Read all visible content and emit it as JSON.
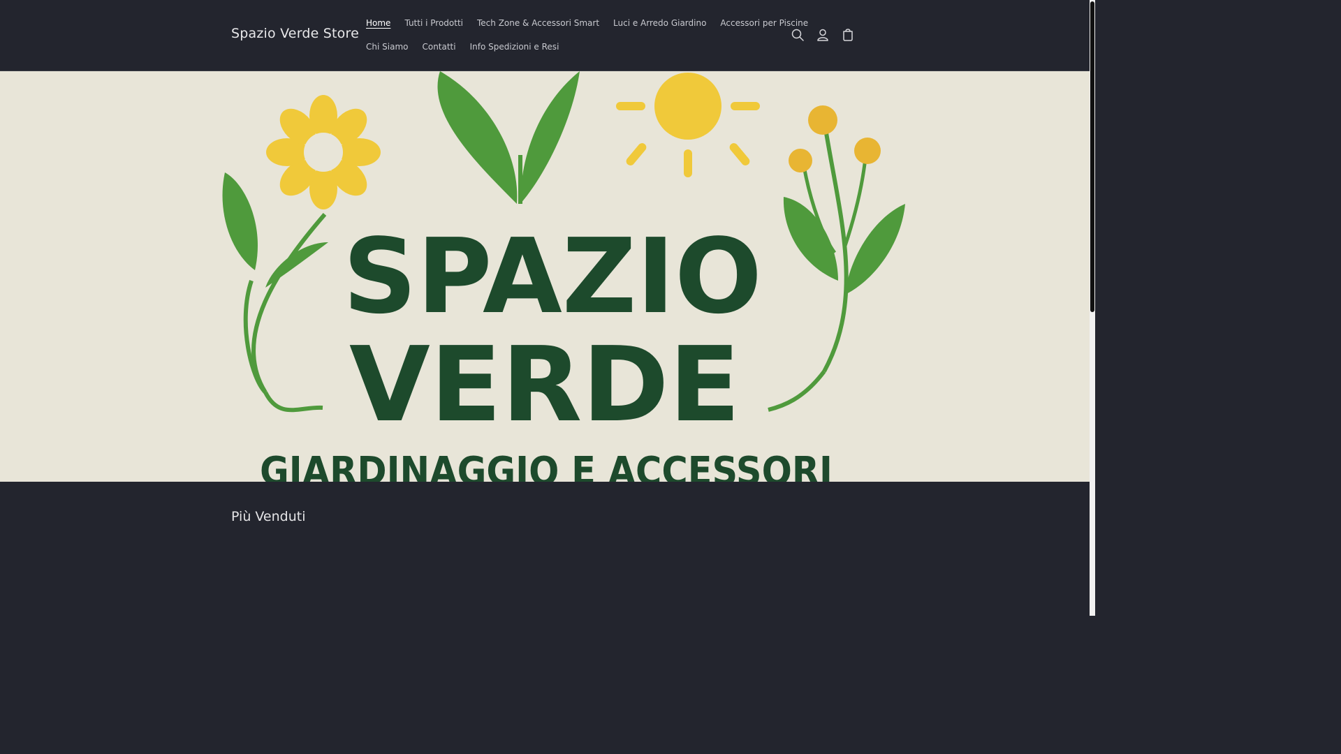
{
  "header": {
    "brand": "Spazio Verde Store",
    "nav_row1": [
      {
        "label": "Home",
        "active": true
      },
      {
        "label": "Tutti i Prodotti",
        "active": false
      },
      {
        "label": "Tech Zone & Accessori Smart",
        "active": false
      },
      {
        "label": "Luci e Arredo Giardino",
        "active": false
      },
      {
        "label": "Accessori per Piscine",
        "active": false
      }
    ],
    "nav_row2": [
      {
        "label": "Chi Siamo",
        "active": false
      },
      {
        "label": "Contatti",
        "active": false
      },
      {
        "label": "Info Spedizioni e Resi",
        "active": false
      }
    ],
    "icons": [
      "search-icon",
      "account-icon",
      "cart-icon"
    ]
  },
  "hero": {
    "logo_line1": "SPAZIO",
    "logo_line2": "VERDE",
    "logo_line3": "GIARDINAGGIO E ACCESSORI",
    "colors": {
      "background": "#e8e5d8",
      "dark_green": "#1d4a2c",
      "leaf_green": "#4f9a3c",
      "yellow": "#f0c93a"
    }
  },
  "bestsellers": {
    "title": "Più Venduti"
  },
  "colors": {
    "header_bg": "#23252e",
    "text": "#e8e8ea"
  }
}
